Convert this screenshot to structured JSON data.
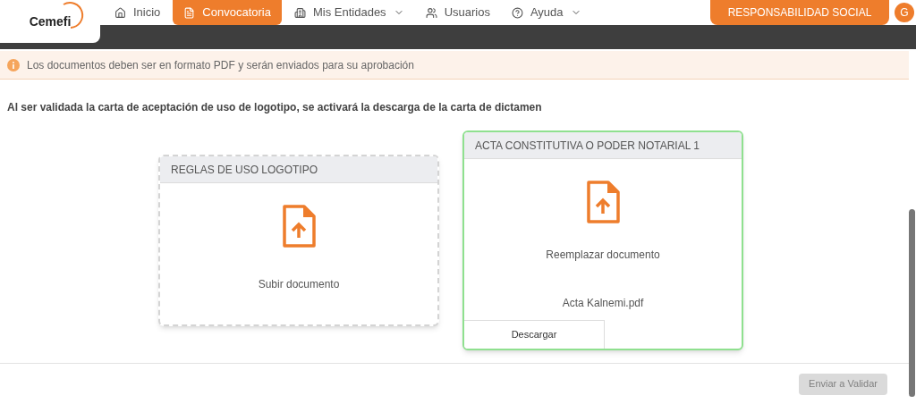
{
  "logo": {
    "text": "Cemefi"
  },
  "nav": [
    {
      "kind": "home",
      "label": "Inicio",
      "selected": false,
      "dropdown": false
    },
    {
      "kind": "document",
      "label": "Convocatoria",
      "selected": true,
      "dropdown": false
    },
    {
      "kind": "building",
      "label": "Mis Entidades",
      "selected": false,
      "dropdown": true
    },
    {
      "kind": "users",
      "label": "Usuarios",
      "selected": false,
      "dropdown": false
    },
    {
      "kind": "help",
      "label": "Ayuda",
      "selected": false,
      "dropdown": true
    }
  ],
  "org_button": "RESPONSABILIDAD SOCIAL",
  "avatar": "G",
  "alert": "Los documentos deben ser en formato PDF y serán enviados para su aprobación",
  "notice": "Al ser validada la carta de aceptación de uso de logotipo, se activará la descarga de la carta de dictamen",
  "cards": [
    {
      "kind": "empty",
      "title": "REGLAS DE USO LOGOTIPO",
      "action": "Subir documento"
    },
    {
      "kind": "uploaded",
      "title": "ACTA CONSTITUTIVA O PODER NOTARIAL 1",
      "action": "Reemplazar documento",
      "file": "Acta Kalnemi.pdf",
      "download": "Descargar"
    }
  ],
  "submit": {
    "label": "Enviar a Validar",
    "disabled": true
  }
}
